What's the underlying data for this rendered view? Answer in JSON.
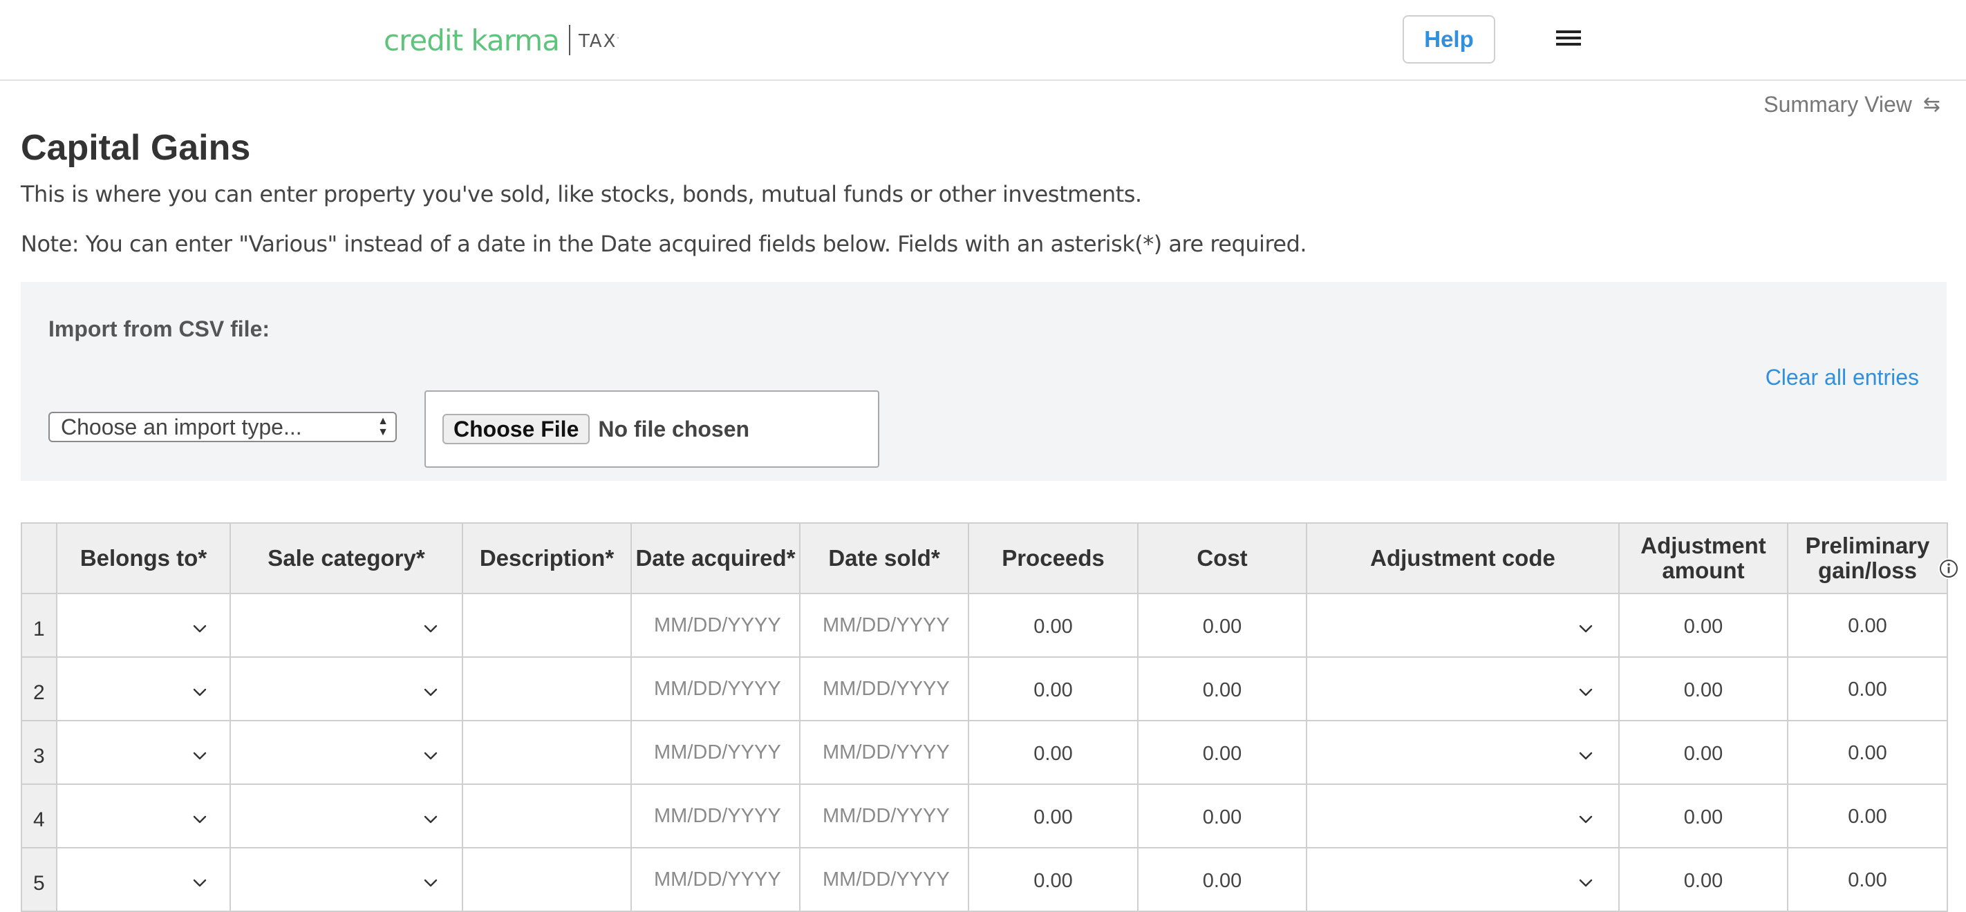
{
  "header": {
    "logo_main": "credit karma",
    "logo_tax": "TAX",
    "help_label": "Help"
  },
  "summary_view_label": "Summary View",
  "page": {
    "title": "Capital Gains",
    "subtitle": "This is where you can enter property you've sold, like stocks, bonds, mutual funds or other investments.",
    "note": "Note: You can enter \"Various\" instead of a date in the Date acquired fields below. Fields with an asterisk(*) are required."
  },
  "import": {
    "label": "Import from CSV file:",
    "select_value": "Choose an import type...",
    "choose_file_label": "Choose File",
    "file_status": "No file chosen",
    "clear_all_label": "Clear all entries"
  },
  "table": {
    "headers": {
      "belongs_to": "Belongs to*",
      "sale_category": "Sale category*",
      "description": "Description*",
      "date_acquired": "Date acquired*",
      "date_sold": "Date sold*",
      "proceeds": "Proceeds",
      "cost": "Cost",
      "adjustment_code": "Adjustment code",
      "adjustment_amount_1": "Adjustment",
      "adjustment_amount_2": "amount",
      "prelim_1": "Preliminary",
      "prelim_2": "gain/loss"
    },
    "date_placeholder": "MM/DD/YYYY",
    "rows": [
      {
        "num": "1",
        "proceeds": "0.00",
        "cost": "0.00",
        "adj_amount": "0.00",
        "prelim": "0.00"
      },
      {
        "num": "2",
        "proceeds": "0.00",
        "cost": "0.00",
        "adj_amount": "0.00",
        "prelim": "0.00"
      },
      {
        "num": "3",
        "proceeds": "0.00",
        "cost": "0.00",
        "adj_amount": "0.00",
        "prelim": "0.00"
      },
      {
        "num": "4",
        "proceeds": "0.00",
        "cost": "0.00",
        "adj_amount": "0.00",
        "prelim": "0.00"
      },
      {
        "num": "5",
        "proceeds": "0.00",
        "cost": "0.00",
        "adj_amount": "0.00",
        "prelim": "0.00"
      }
    ]
  },
  "colors": {
    "brand_green": "#5ec47b",
    "link_blue": "#2f8fe0"
  }
}
